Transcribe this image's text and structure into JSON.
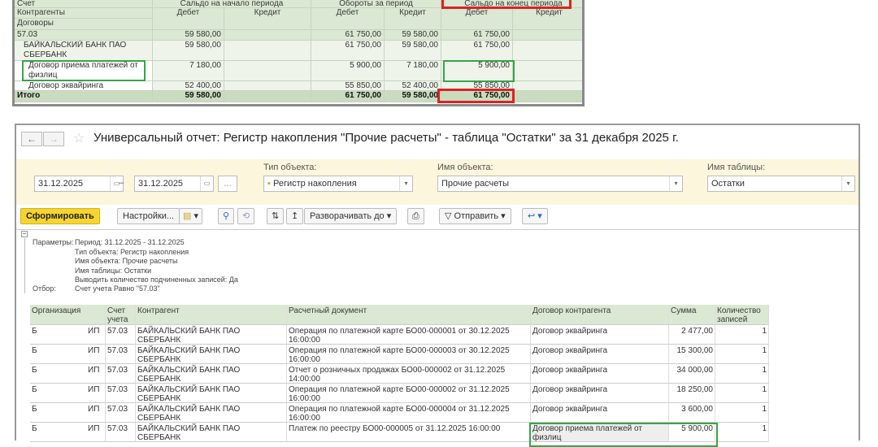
{
  "top_report": {
    "headers": {
      "account": "Счет",
      "counterparties": "Контрагенты",
      "contracts": "Договоры",
      "opening": "Сальдо на начало периода",
      "turnover": "Обороты за период",
      "closing": "Сальдо на конец периода",
      "debit": "Дебет",
      "credit": "Кредит"
    },
    "rows": [
      {
        "label": "57.03",
        "v": [
          "59 580,00",
          "",
          "61 750,00",
          "59 580,00",
          "61 750,00",
          ""
        ]
      },
      {
        "label": "БАЙКАЛЬСКИЙ БАНК ПАО СБЕРБАНК",
        "v": [
          "59 580,00",
          "",
          "61 750,00",
          "59 580,00",
          "61 750,00",
          ""
        ]
      },
      {
        "label": "Договор приема платежей от физлиц",
        "v": [
          "7 180,00",
          "",
          "5 900,00",
          "7 180,00",
          "5 900,00",
          ""
        ]
      },
      {
        "label": "Договор эквайринга",
        "v": [
          "52 400,00",
          "",
          "55 850,00",
          "52 400,00",
          "55 850,00",
          ""
        ]
      }
    ],
    "total": {
      "label": "Итого",
      "v": [
        "59 580,00",
        "",
        "61 750,00",
        "59 580,00",
        "61 750,00",
        ""
      ]
    }
  },
  "window": {
    "title": "Универсальный отчет: Регистр накопления \"Прочие расчеты\" - таблица \"Остатки\" за 31 декабря 2025 г.",
    "filters": {
      "date_from": "31.12.2025",
      "date_to": "31.12.2025",
      "dash": "–",
      "more": "...",
      "object_type_label": "Тип объекта:",
      "object_type": "Регистр накопления",
      "object_name_label": "Имя объекта:",
      "object_name": "Прочие расчеты",
      "table_name_label": "Имя таблицы:",
      "table_name": "Остатки"
    },
    "toolbar": {
      "generate": "Сформировать",
      "settings": "Настройки...",
      "expand": "Разворачивать до",
      "send": "Отправить"
    },
    "params": {
      "params_label": "Параметры:",
      "filter_label": "Отбор:",
      "lines": [
        "Период: 31.12.2025 - 31.12.2025",
        "Тип объекта: Регистр накопления",
        "Имя объекта: Прочие расчеты",
        "Имя таблицы: Остатки",
        "Выводить количество подчиненных записей: Да"
      ],
      "filter": "Счет учета Равно \"57.03\""
    },
    "table": {
      "columns": [
        "Организация",
        "Счет учета",
        "Контрагент",
        "Расчетный документ",
        "Договор контрагента",
        "Сумма",
        "Количество записей"
      ],
      "rows": [
        {
          "org": "Б",
          "org2": "ИП",
          "acc": "57.03",
          "cp": "БАЙКАЛЬСКИЙ БАНК ПАО СБЕРБАНК",
          "doc": "Операция по платежной карте БО00-000001 от 30.12.2025 16:00:00",
          "contract": "Договор эквайринга",
          "sum": "2 477,00",
          "count": "1"
        },
        {
          "org": "Б",
          "org2": "ИП",
          "acc": "57.03",
          "cp": "БАЙКАЛЬСКИЙ БАНК ПАО СБЕРБАНК",
          "doc": "Операция по платежной карте БО00-000003 от 30.12.2025 16:00:00",
          "contract": "Договор эквайринга",
          "sum": "15 300,00",
          "count": "1"
        },
        {
          "org": "Б",
          "org2": "ИП",
          "acc": "57.03",
          "cp": "БАЙКАЛЬСКИЙ БАНК ПАО СБЕРБАНК",
          "doc": "Отчет о розничных продажах БО00-000002 от 31.12.2025 14:00:00",
          "contract": "Договор эквайринга",
          "sum": "34 000,00",
          "count": "1"
        },
        {
          "org": "Б",
          "org2": "ИП",
          "acc": "57.03",
          "cp": "БАЙКАЛЬСКИЙ БАНК ПАО СБЕРБАНК",
          "doc": "Операция по платежной карте БО00-000002 от 31.12.2025 16:00:00",
          "contract": "Договор эквайринга",
          "sum": "18 250,00",
          "count": "1"
        },
        {
          "org": "Б",
          "org2": "ИП",
          "acc": "57.03",
          "cp": "БАЙКАЛЬСКИЙ БАНК ПАО СБЕРБАНК",
          "doc": "Операция по платежной карте БО00-000004 от 31.12.2025 16:00:00",
          "contract": "Договор эквайринга",
          "sum": "3 600,00",
          "count": "1"
        },
        {
          "org": "Б",
          "org2": "ИП",
          "acc": "57.03",
          "cp": "БАЙКАЛЬСКИЙ БАНК ПАО СБЕРБАНК",
          "doc": "Платеж по реестру БО00-000005 от 31.12.2025 16:00:00",
          "contract": "Договор приема платежей от физлиц",
          "sum": "5 900,00",
          "count": "1"
        }
      ]
    }
  },
  "colors": {
    "header_green": "#dbe8d3",
    "highlight_red": "#d22222",
    "highlight_green": "#3aa34a",
    "generate_yellow": "#f7d530"
  }
}
